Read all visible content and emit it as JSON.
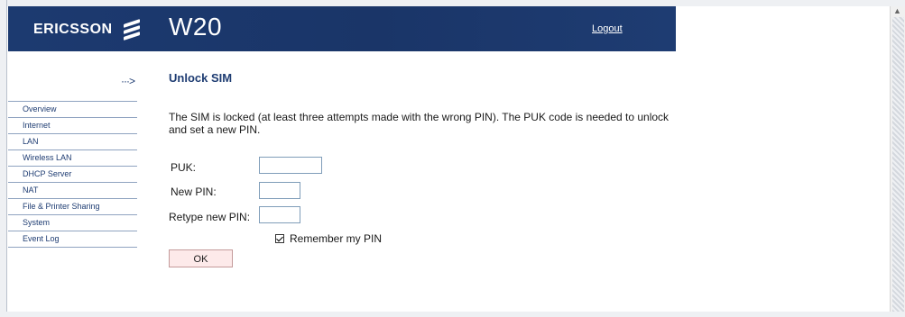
{
  "header": {
    "brand": "ERICSSON",
    "brand_icon": "ericsson-logo-icon",
    "model": "W20",
    "logout_label": "Logout"
  },
  "nav": {
    "arrow_glyph": "···>",
    "items": [
      {
        "label": "Overview"
      },
      {
        "label": "Internet"
      },
      {
        "label": "LAN"
      },
      {
        "label": "Wireless LAN"
      },
      {
        "label": "DHCP Server"
      },
      {
        "label": "NAT"
      },
      {
        "label": "File & Printer Sharing"
      },
      {
        "label": "System"
      },
      {
        "label": "Event Log"
      }
    ]
  },
  "main": {
    "title": "Unlock SIM",
    "message": "The SIM is locked (at least three attempts made with the wrong PIN). The PUK code is needed to unlock and set a new PIN.",
    "puk_label": "PUK:",
    "puk_value": "",
    "new_pin_label": "New PIN:",
    "new_pin_value": "",
    "retype_pin_label": "Retype new PIN:",
    "retype_pin_value": "",
    "remember_label": "Remember my PIN",
    "remember_checked": true,
    "ok_label": "OK"
  },
  "colors": {
    "header_bg": "#1c3a70",
    "link": "#1e3c72",
    "ok_button_bg": "#fdeaea"
  }
}
